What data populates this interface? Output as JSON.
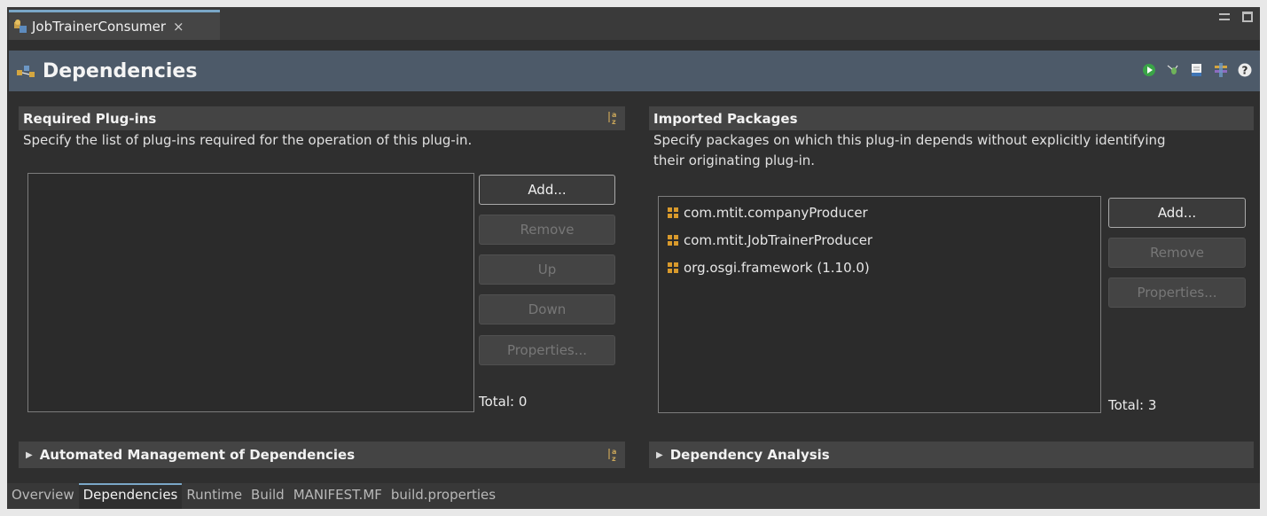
{
  "editor_tab": {
    "label": "JobTrainerConsumer",
    "close": "×"
  },
  "header": {
    "title": "Dependencies"
  },
  "required": {
    "title": "Required Plug-ins",
    "description": "Specify the list of plug-ins required for the operation of this plug-in.",
    "buttons": {
      "add": "Add...",
      "remove": "Remove",
      "up": "Up",
      "down": "Down",
      "properties": "Properties..."
    },
    "total": "Total: 0",
    "items": []
  },
  "imported": {
    "title": "Imported Packages",
    "description_line1": "Specify packages on which this plug-in depends without explicitly identifying",
    "description_line2": "their originating plug-in.",
    "buttons": {
      "add": "Add...",
      "remove": "Remove",
      "properties": "Properties..."
    },
    "total": "Total: 3",
    "items": [
      {
        "label": "com.mtit.companyProducer"
      },
      {
        "label": "com.mtit.JobTrainerProducer"
      },
      {
        "label": "org.osgi.framework (1.10.0)"
      }
    ]
  },
  "automated": {
    "title": "Automated Management of Dependencies"
  },
  "analysis": {
    "title": "Dependency Analysis"
  },
  "page_tabs": [
    "Overview",
    "Dependencies",
    "Runtime",
    "Build",
    "MANIFEST.MF",
    "build.properties"
  ],
  "active_page_tab": "Dependencies",
  "icons": {
    "tab": "plugin-manifest-icon",
    "header": "dependencies-icon",
    "tools": [
      "run-icon",
      "debug-icon",
      "export-icon",
      "organize-icon",
      "help-icon"
    ],
    "sort": "alphabetical-sort-icon",
    "package": "package-icon"
  }
}
